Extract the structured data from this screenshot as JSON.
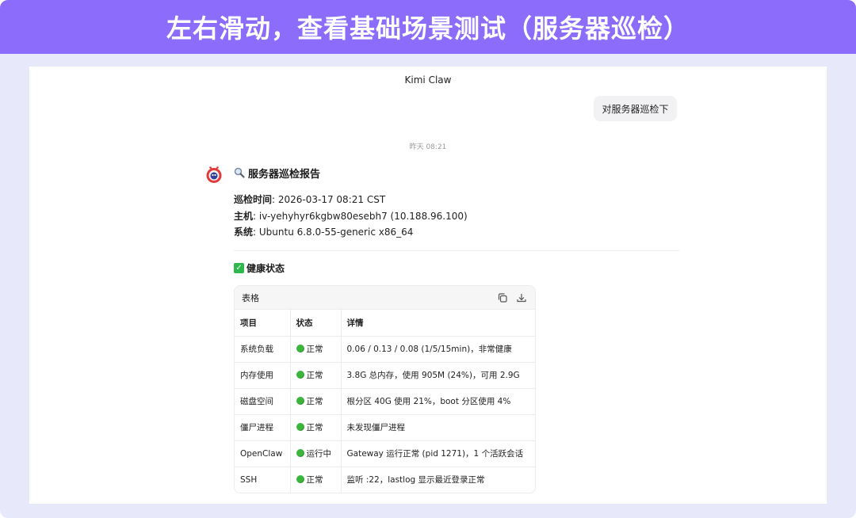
{
  "banner": {
    "title": "左右滑动，查看基础场景测试（服务器巡检）"
  },
  "app": {
    "title": "Kimi Claw"
  },
  "user_message": "对服务器巡检下",
  "timestamp": "昨天 08:21",
  "report": {
    "title": "服务器巡检报告",
    "icon": "magnifier-icon",
    "meta": [
      {
        "label": "巡检时间",
        "value": ": 2026-03-17 08:21 CST"
      },
      {
        "label": "主机",
        "value": ": iv-yehyhyr6kgbw80esebh7 (10.188.96.100)"
      },
      {
        "label": "系统",
        "value": ": Ubuntu 6.8.0-55-generic x86_64"
      }
    ],
    "health_title": "健康状态",
    "health_icon": "check-mark-icon"
  },
  "table": {
    "label": "表格",
    "copy_icon": "copy-icon",
    "download_icon": "download-icon",
    "headers": [
      "项目",
      "状态",
      "详情"
    ],
    "rows": [
      {
        "item": "系统负载",
        "status": "正常",
        "detail": "0.06 / 0.13 / 0.08 (1/5/15min)，非常健康"
      },
      {
        "item": "内存使用",
        "status": "正常",
        "detail": "3.8G 总内存，使用 905M (24%)，可用 2.9G"
      },
      {
        "item": "磁盘空间",
        "status": "正常",
        "detail": "根分区 40G 使用 21%，boot 分区使用 4%"
      },
      {
        "item": "僵尸进程",
        "status": "正常",
        "detail": "未发现僵尸进程"
      },
      {
        "item": "OpenClaw",
        "status": "运行中",
        "detail": "Gateway 运行正常 (pid 1271)，1 个活跃会话"
      },
      {
        "item": "SSH",
        "status": "正常",
        "detail": "监听 :22，lastlog 显示最近登录正常"
      }
    ]
  },
  "colors": {
    "banner": "#8b6cfb",
    "frame": "#e8e8fb",
    "status_dot": "#3cb53c"
  }
}
